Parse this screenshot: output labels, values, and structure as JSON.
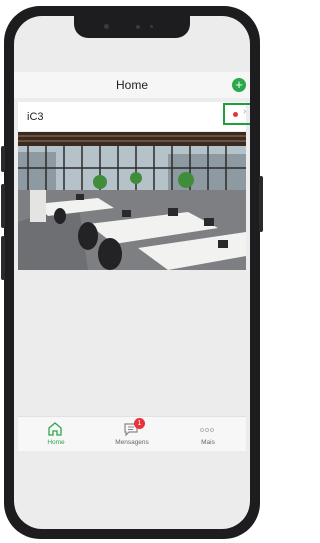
{
  "header": {
    "title": "Home"
  },
  "device": {
    "name": "iC3",
    "recording_icon": "record-dot-icon"
  },
  "tabs": [
    {
      "label": "Home",
      "icon": "home-icon",
      "active": true
    },
    {
      "label": "Mensagens",
      "icon": "message-icon",
      "badge": "1"
    },
    {
      "label": "Mais",
      "icon": "more-dots-icon"
    }
  ],
  "colors": {
    "accent": "#2aa84a",
    "alert": "#e8323c"
  }
}
